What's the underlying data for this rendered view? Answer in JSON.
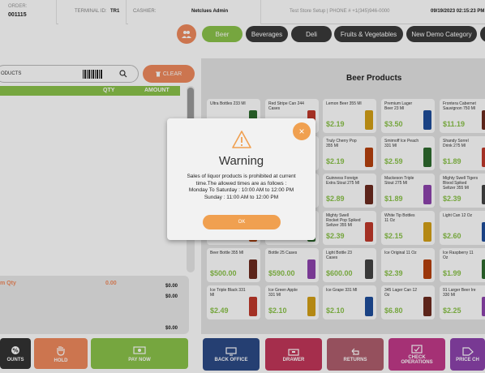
{
  "header": {
    "order_label": "ORDER:",
    "order_value": "001115",
    "terminal_label": "TERMINAL ID:",
    "terminal_value": "TR1",
    "cashier_label": "CASHIER:",
    "cashier_value": "Netclues Admin",
    "store_text": "Test Store Setup | PHONE # +1(345)946-0000",
    "datetime": "09/19/2023 02:15:23 PM"
  },
  "categories": [
    {
      "label": "Beer",
      "active": true
    },
    {
      "label": "Beverages",
      "active": false
    },
    {
      "label": "Deli",
      "active": false
    },
    {
      "label": "Fruits & Vegetables",
      "active": false
    },
    {
      "label": "New Demo Category",
      "active": false
    }
  ],
  "cart": {
    "search_placeholder": "ODUCTS",
    "clear_label": "CLEAR",
    "col_qty": "QTY",
    "col_amount": "AMOUNT",
    "item_qty_label": "m Qty",
    "item_qty_value": "0.00",
    "totals": [
      "$0.00",
      "$0.00",
      "$0.00"
    ]
  },
  "actions": {
    "discounts": "OUNTS",
    "hold": "HOLD",
    "pay_now": "PAY NOW",
    "back_office": "BACK OFFICE",
    "drawer": "DRAWER",
    "returns": "RETURNS",
    "check_operations": "CHECK OPERATIONS",
    "price_check": "PRICE CH"
  },
  "products_title": "Beer Products",
  "products": [
    {
      "name": "Ultra Bottles 233 Ml",
      "price": ""
    },
    {
      "name": "Red Stripe Can 244 Cases",
      "price": ""
    },
    {
      "name": "Lemon Beer 355 Ml",
      "price": "$2.19"
    },
    {
      "name": "Premium Lager Beer 23 Ml",
      "price": "$3.50"
    },
    {
      "name": "Frontera Cabernet Sauvignon 750 Ml",
      "price": "$11.19"
    },
    {
      "name": "",
      "price": ""
    },
    {
      "name": "",
      "price": ""
    },
    {
      "name": "Truly Cherry Pop 355 Ml",
      "price": "$2.19"
    },
    {
      "name": "Smirnoff Ice Peach 331 Ml",
      "price": "$2.59"
    },
    {
      "name": "Shandy Sorrel Drink 275 Ml",
      "price": "$1.89"
    },
    {
      "name": "",
      "price": ""
    },
    {
      "name": "",
      "price": ""
    },
    {
      "name": "Guinness Foreign Extra Stout 275 Ml",
      "price": "$2.89"
    },
    {
      "name": "Mackeson Triple Stout 275 Ml",
      "price": "$1.89"
    },
    {
      "name": "Mighty Swell Tigers Blood Spiked Seltzer 355 Ml",
      "price": "$2.39"
    },
    {
      "name": "",
      "price": ""
    },
    {
      "name": "",
      "price": ""
    },
    {
      "name": "Mighty Swell Rocket Pop Spiked Seltzer 355 Ml",
      "price": "$2.39"
    },
    {
      "name": "White Tip Bottles 11 Oz",
      "price": "$2.15"
    },
    {
      "name": "Light Can 12 Oz",
      "price": "$2.60"
    },
    {
      "name": "Beer Bottle 355 Ml",
      "price": "$500.00"
    },
    {
      "name": "Bottle 25 Cases",
      "price": "$590.00"
    },
    {
      "name": "Light Bottle 23 Cases",
      "price": "$600.00"
    },
    {
      "name": "Ice Original 11 Oz",
      "price": "$2.39"
    },
    {
      "name": "Ice Raspberry 11 Oz",
      "price": "$1.99"
    },
    {
      "name": "Ice Triple Black 331 Ml",
      "price": "$2.49"
    },
    {
      "name": "Ice Green Apple 331 Ml",
      "price": "$2.10"
    },
    {
      "name": "Ice Grape 331 Ml",
      "price": "$2.10"
    },
    {
      "name": "345 Lager Can 12 Oz",
      "price": "$6.80"
    },
    {
      "name": "91 Larger Beer Ire 330 Ml",
      "price": "$2.25"
    }
  ],
  "modal": {
    "title": "Warning",
    "body_line1": "Sales of liquor products is prohibited at current",
    "body_line2": "time.The allowed times are as follows :",
    "body_line3": "Monday To Saturday : 10:00 AM to 12:00 PM",
    "body_line4": "Sunday : 11:00 AM to 12:00 PM",
    "ok_label": "OK",
    "close_glyph": "×"
  },
  "colors": {
    "accent_green": "#8bc34a",
    "accent_orange": "#f08a5d",
    "modal_button": "#f0a050"
  }
}
